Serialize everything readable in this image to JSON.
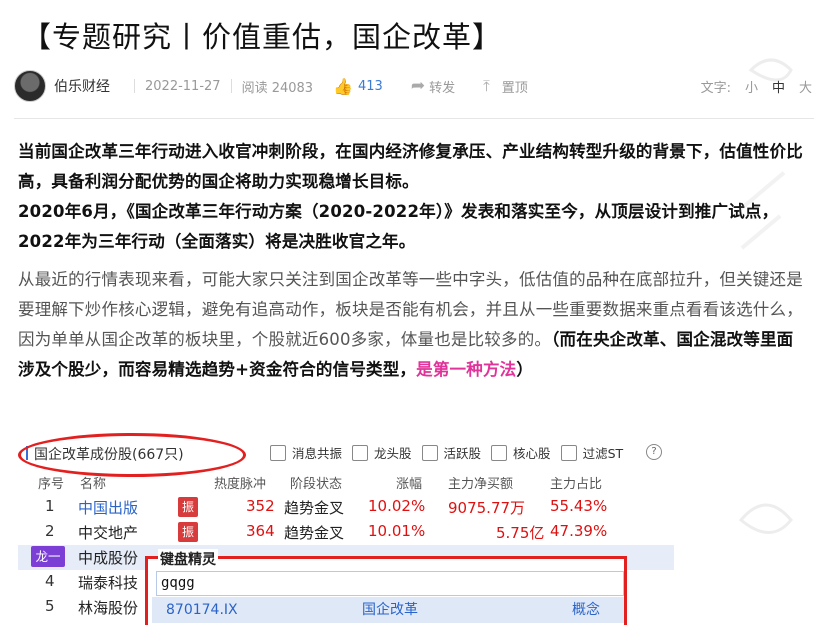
{
  "article": {
    "title": "【专题研究丨价值重估，国企改革】",
    "author": "伯乐财经",
    "date": "2022-11-27",
    "read_label": "阅读",
    "read_count": "24083",
    "likes": "413",
    "share_label": "转发",
    "pin_label": "置顶",
    "font_label": "文字:",
    "font_small": "小",
    "font_mid": "中",
    "font_large": "大"
  },
  "body": {
    "p1a": "当前国企改革三年行动进入收官冲刺阶段，在国内经济修复承压、产业结构转型升级的背景下，估值性价比高，具备利润分配优势的国企将助力实现稳增长目标。",
    "p1b": "2020年6月，《国企改革三年行动方案（2020-2022年）》发表和落实至今，从顶层设计到推广试点，2022年为三年行动（全面落实）将是决胜收官之年。",
    "p2a": "从最近的行情表现来看，可能大家只关注到国企改革等一些中字头，低估值的品种在底部拉升，但关键还是要理解下炒作核心逻辑，避免有追高动作，板块是否能有机会，并且从一些重要数据来重点看看该选什么，因为单单从国企改革的板块里，个股就近600多家，体量也是比较多的。",
    "p2b": "（而在央企改革、国企混改等里面涉及个股少，而容易精选趋势+资金符合的信号类型，",
    "p2c": "是第一种方法",
    "p2d": "）"
  },
  "screenshot": {
    "tab_label": "国企改革成份股(667只)",
    "checks": [
      "消息共振",
      "龙头股",
      "活跃股",
      "核心股",
      "过滤ST"
    ],
    "help": "?",
    "headers": [
      "序号",
      "名称",
      "热度脉冲",
      "阶段状态",
      "涨幅",
      "主力净买额",
      "主力占比"
    ],
    "rows": [
      {
        "no": "1",
        "name": "中国出版",
        "badge": "振",
        "pulse": "352",
        "state": "趋势金叉",
        "chg": "10.02%",
        "flow": "9075.77万",
        "ratio": "55.43%"
      },
      {
        "no": "2",
        "name": "中交地产",
        "badge": "振",
        "pulse": "364",
        "state": "趋势金叉",
        "chg": "10.01%",
        "flow": "5.75亿",
        "ratio": "47.39%"
      },
      {
        "no": "龙一",
        "name": "中成股份",
        "badge": "",
        "pulse": "",
        "state": "",
        "chg": "",
        "flow": "",
        "ratio": ""
      },
      {
        "no": "4",
        "name": "瑞泰科技",
        "badge": "",
        "pulse": "",
        "state": "",
        "chg": "",
        "flow": "",
        "ratio": ""
      },
      {
        "no": "5",
        "name": "林海股份",
        "badge": "",
        "pulse": "",
        "state": "",
        "chg": "",
        "flow": "",
        "ratio": ""
      }
    ],
    "popup": {
      "title": "键盘精灵",
      "input": "gqgg",
      "code": "870174.IX",
      "name": "国企改革",
      "type": "概念"
    }
  }
}
